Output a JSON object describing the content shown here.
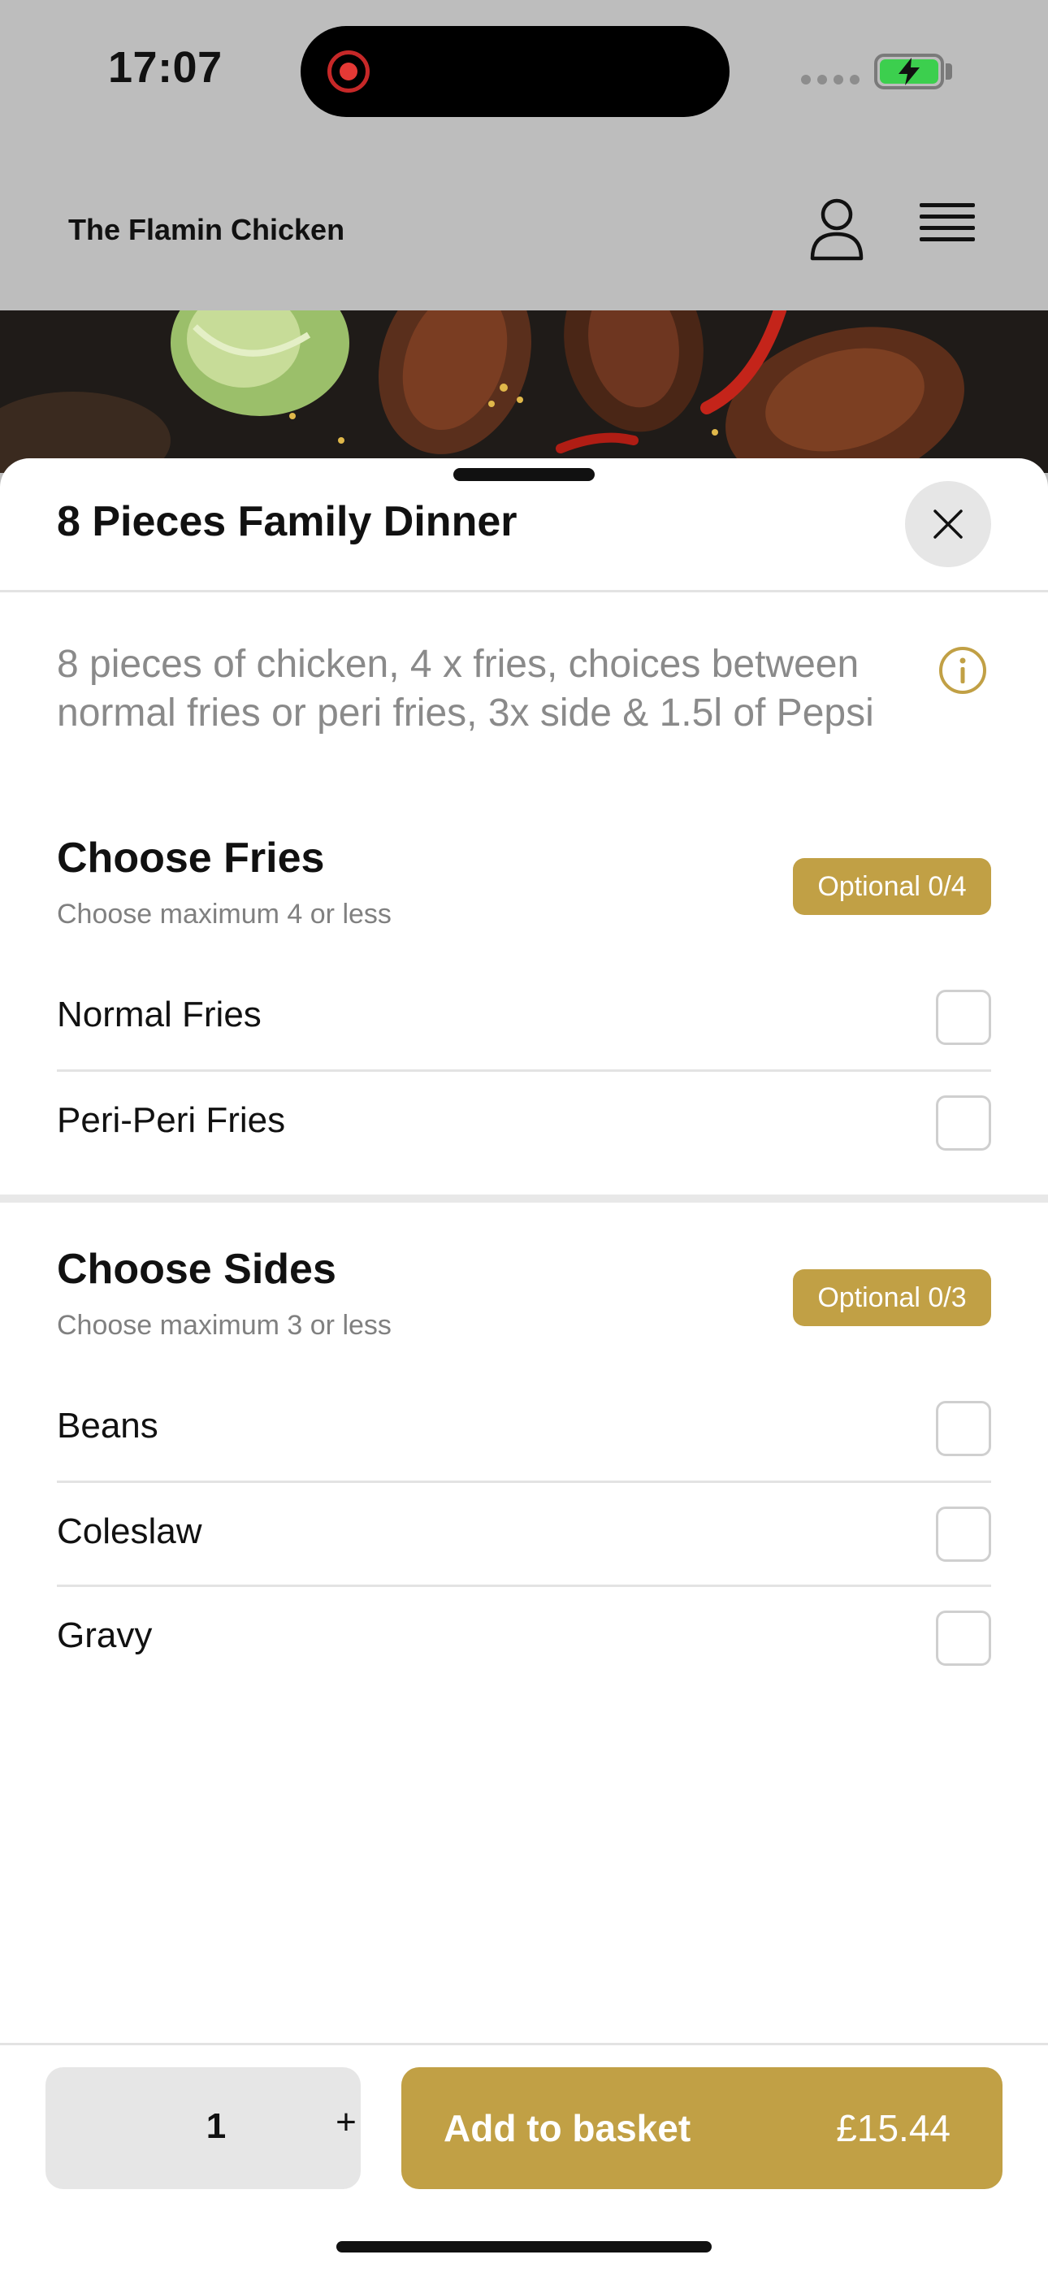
{
  "status_bar": {
    "time": "17:07"
  },
  "app_header": {
    "brand": "The Flamin Chicken"
  },
  "sheet": {
    "title": "8 Pieces Family Dinner",
    "description": "8 pieces of chicken, 4 x fries, choices between normal fries or peri fries, 3x side & 1.5l of Pepsi",
    "groups": [
      {
        "title": "Choose Fries",
        "subtitle": "Choose maximum 4 or less",
        "badge": "Optional 0/4",
        "options": [
          {
            "label": "Normal Fries",
            "checked": false
          },
          {
            "label": "Peri-Peri Fries",
            "checked": false
          }
        ]
      },
      {
        "title": "Choose Sides",
        "subtitle": "Choose maximum 3 or less",
        "badge": "Optional 0/3",
        "options": [
          {
            "label": "Beans",
            "checked": false
          },
          {
            "label": "Coleslaw",
            "checked": false
          },
          {
            "label": "Gravy",
            "checked": false
          }
        ]
      }
    ]
  },
  "footer": {
    "quantity": "1",
    "plus": "+",
    "add_label": "Add to basket",
    "price": "£15.44"
  },
  "colors": {
    "accent": "#c1a045",
    "header_bg": "#bdbdbd",
    "close_bg": "#e6e6e6"
  },
  "icons": {
    "recording": "recording-icon",
    "battery": "battery-charging-icon",
    "user": "user-icon",
    "menu": "hamburger-menu-icon",
    "close": "close-icon",
    "info": "info-icon"
  }
}
